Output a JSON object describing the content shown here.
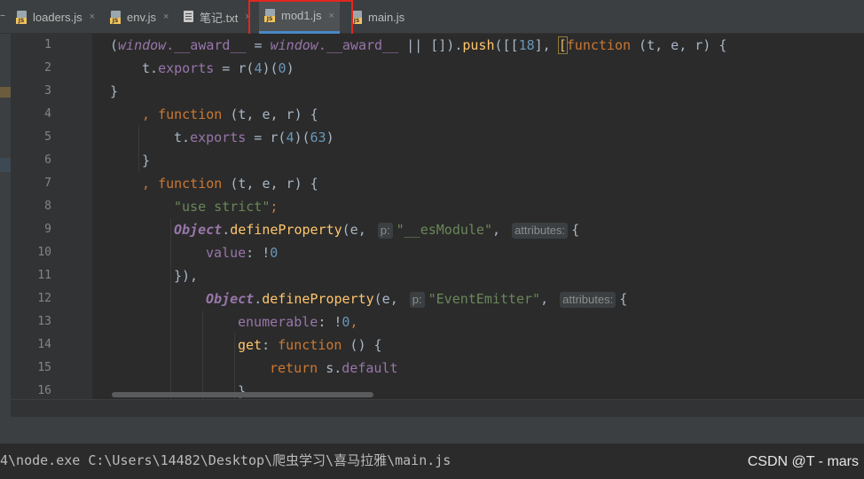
{
  "tabs": [
    {
      "label": "loaders.js",
      "icon": "js-file-icon",
      "active": false
    },
    {
      "label": "env.js",
      "icon": "js-file-icon",
      "active": false
    },
    {
      "label": "笔记.txt",
      "icon": "text-file-icon",
      "active": false
    },
    {
      "label": "mod1.js",
      "icon": "js-file-icon",
      "active": true
    },
    {
      "label": "main.js",
      "icon": "js-file-icon",
      "active": false
    }
  ],
  "js_badge": "JS",
  "close_glyph": "×",
  "line_numbers": [
    "1",
    "2",
    "3",
    "4",
    "5",
    "6",
    "7",
    "8",
    "9",
    "10",
    "11",
    "12",
    "13",
    "14",
    "15",
    "16"
  ],
  "code": {
    "l1": {
      "open": "(",
      "win1": "window",
      "aw1": ".__award__",
      "eq": " = ",
      "win2": "window",
      "aw2": ".__award__",
      "rest": " || []).",
      "push": "push",
      "p2": "([[",
      "n18": "18",
      "p3": "], ",
      "br": "[",
      "fn": "function",
      "args": " (t, e, r) {"
    },
    "l2": {
      "t": "t.",
      "exports": "exports",
      "mid": " = r(",
      "n4": "4",
      "mid2": ")(",
      "n0": "0",
      "end": ")"
    },
    "l3": {
      "text": "}"
    },
    "l4": {
      "comma": ", ",
      "fn": "function",
      "args": " (t, e, r) {"
    },
    "l5": {
      "t": "t.",
      "exports": "exports",
      "mid": " = r(",
      "n4": "4",
      "mid2": ")(",
      "n63": "63",
      "end": ")"
    },
    "l6": {
      "text": "}"
    },
    "l7": {
      "comma": ", ",
      "fn": "function",
      "args": " (t, e, r) {"
    },
    "l8": {
      "str": "\"use strict\"",
      "semi": ";"
    },
    "l9": {
      "obj": "Object",
      "dot": ".",
      "method": "defineProperty",
      "open": "(e, ",
      "hint_p": "p:",
      "str": "\"__esModule\"",
      "comma": ", ",
      "hint_attr": "attributes:",
      "brace": "{"
    },
    "l10": {
      "key": "value",
      "colon": ": !",
      "n0": "0"
    },
    "l11": {
      "text": "}),"
    },
    "l12": {
      "obj": "Object",
      "dot": ".",
      "method": "defineProperty",
      "open": "(e, ",
      "hint_p": "p:",
      "str": "\"EventEmitter\"",
      "comma": ", ",
      "hint_attr": "attributes:",
      "brace": "{"
    },
    "l13": {
      "key": "enumerable",
      "colon": ": !",
      "n0": "0",
      "comma": ","
    },
    "l14": {
      "key": "get",
      "colon": ": ",
      "fn": "function",
      "rest": " () {"
    },
    "l15": {
      "ret": "return",
      "sp": " s.",
      "prop": "default"
    },
    "l16": {
      "text": "}"
    }
  },
  "terminal": {
    "command": "4\\node.exe C:\\Users\\14482\\Desktop\\爬虫学习\\喜马拉雅\\main.js"
  },
  "watermark": "CSDN @T - mars",
  "colors": {
    "keyword": "#cc7832",
    "global": "#9876aa",
    "number": "#6897bb",
    "string": "#6a8759",
    "function": "#ffc66d",
    "highlight_box": "#e0281e"
  }
}
